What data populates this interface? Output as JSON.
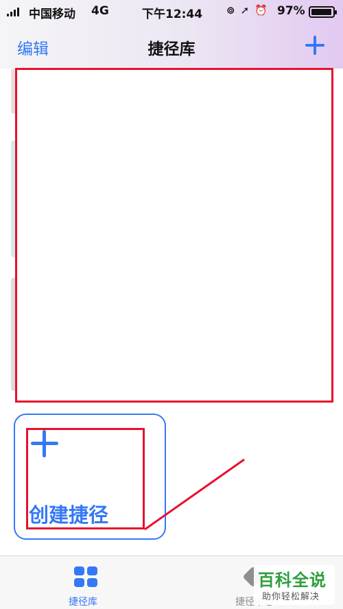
{
  "status_bar": {
    "carrier": "中国移动",
    "network": "4G",
    "time": "下午12:44",
    "battery_percent": "97%",
    "battery_level": 0.97
  },
  "nav": {
    "edit_label": "编辑",
    "title": "捷径库"
  },
  "create_card": {
    "label": "创建捷径"
  },
  "tabs": [
    {
      "label": "捷径库",
      "selected": true
    },
    {
      "label": "捷径中心",
      "selected": false
    }
  ],
  "watermark": {
    "title": "百科全说",
    "subtitle": "助你轻松解决"
  },
  "colors": {
    "accent": "#3478f6",
    "annotation_red": "#e8112d",
    "watermark_green": "#2d9e3a"
  }
}
